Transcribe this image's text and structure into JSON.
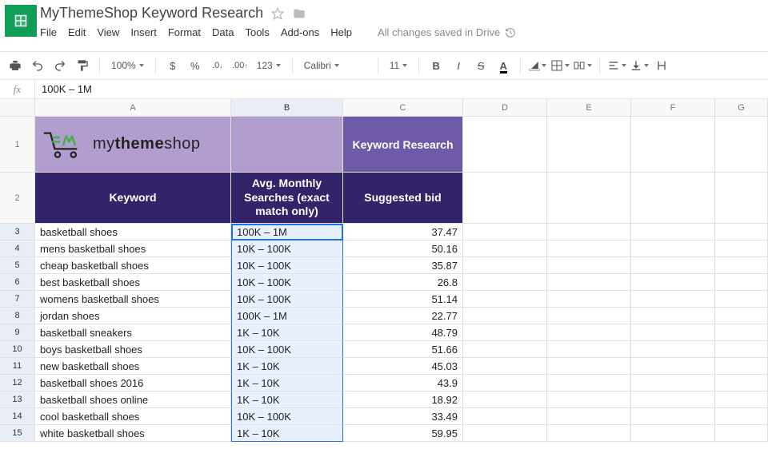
{
  "doc": {
    "title": "MyThemeShop Keyword Research",
    "save_status": "All changes saved in Drive"
  },
  "menu": {
    "file": "File",
    "edit": "Edit",
    "view": "View",
    "insert": "Insert",
    "format": "Format",
    "data": "Data",
    "tools": "Tools",
    "addons": "Add-ons",
    "help": "Help"
  },
  "toolbar": {
    "zoom": "100%",
    "currency": "$",
    "percent": "%",
    "dec_dec": ".0",
    "inc_dec": ".00",
    "num_format": "123",
    "font_name": "Calibri",
    "font_size": "11",
    "bold": "B",
    "italic": "I",
    "strike": "S",
    "textcolor": "A"
  },
  "formula": {
    "fx": "fx",
    "value": "100K – 1M"
  },
  "columns": [
    "A",
    "B",
    "C",
    "D",
    "E",
    "F",
    "G"
  ],
  "sheet": {
    "brand_my": "my",
    "brand_theme": "theme",
    "brand_shop": "shop",
    "header_c1": "Keyword Research",
    "header_a2": "Keyword",
    "header_b2": "Avg. Monthly Searches (exact match only)",
    "header_c2": "Suggested bid"
  },
  "rows": [
    {
      "n": "1"
    },
    {
      "n": "2"
    },
    {
      "n": "3",
      "keyword": "basketball shoes",
      "searches": "100K – 1M",
      "bid": "37.47"
    },
    {
      "n": "4",
      "keyword": "mens basketball shoes",
      "searches": "10K – 100K",
      "bid": "50.16"
    },
    {
      "n": "5",
      "keyword": "cheap basketball shoes",
      "searches": "10K – 100K",
      "bid": "35.87"
    },
    {
      "n": "6",
      "keyword": "best basketball shoes",
      "searches": "10K – 100K",
      "bid": "26.8"
    },
    {
      "n": "7",
      "keyword": "womens basketball shoes",
      "searches": "10K – 100K",
      "bid": "51.14"
    },
    {
      "n": "8",
      "keyword": "jordan shoes",
      "searches": "100K – 1M",
      "bid": "22.77"
    },
    {
      "n": "9",
      "keyword": "basketball sneakers",
      "searches": "1K – 10K",
      "bid": "48.79"
    },
    {
      "n": "10",
      "keyword": "boys basketball shoes",
      "searches": "10K – 100K",
      "bid": "51.66"
    },
    {
      "n": "11",
      "keyword": "new basketball shoes",
      "searches": "1K – 10K",
      "bid": "45.03"
    },
    {
      "n": "12",
      "keyword": "basketball shoes 2016",
      "searches": "1K – 10K",
      "bid": "43.9"
    },
    {
      "n": "13",
      "keyword": "basketball shoes online",
      "searches": "1K – 10K",
      "bid": "18.92"
    },
    {
      "n": "14",
      "keyword": "cool basketball shoes",
      "searches": "10K – 100K",
      "bid": "33.49"
    },
    {
      "n": "15",
      "keyword": "white basketball shoes",
      "searches": "1K – 10K",
      "bid": "59.95"
    }
  ]
}
